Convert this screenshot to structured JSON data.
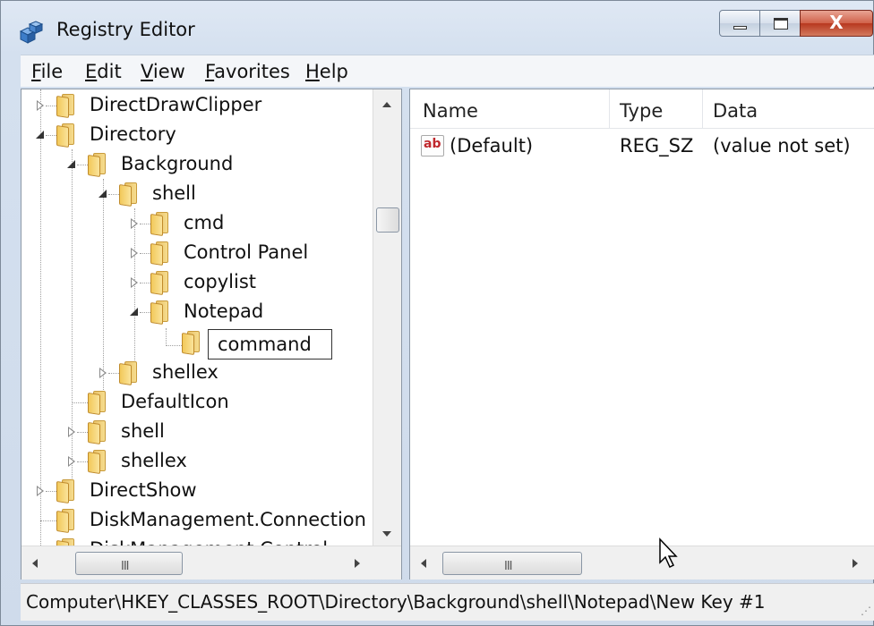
{
  "window": {
    "title": "Registry Editor",
    "app_icon": "registry-cubes-icon",
    "caption_buttons": {
      "minimize_icon": "minimize-icon",
      "maximize_icon": "maximize-icon",
      "close_icon": "close-icon",
      "close_glyph": "X"
    }
  },
  "menu": {
    "items": [
      {
        "accel": "F",
        "rest": "ile"
      },
      {
        "accel": "E",
        "rest": "dit"
      },
      {
        "accel": "V",
        "rest": "iew"
      },
      {
        "accel": "F",
        "rest": "avorites"
      },
      {
        "accel": "H",
        "rest": "elp"
      }
    ]
  },
  "tree": {
    "nodes": [
      {
        "label": "DirectDrawClipper",
        "state": "collapsed"
      },
      {
        "label": "Directory",
        "state": "expanded"
      },
      {
        "label": "Background",
        "state": "expanded"
      },
      {
        "label": "shell",
        "state": "expanded"
      },
      {
        "label": "cmd",
        "state": "collapsed"
      },
      {
        "label": "Control Panel",
        "state": "collapsed"
      },
      {
        "label": "copylist",
        "state": "collapsed"
      },
      {
        "label": "Notepad",
        "state": "expanded"
      },
      {
        "label": "command",
        "state": "renaming"
      },
      {
        "label": "shellex",
        "state": "collapsed"
      },
      {
        "label": "DefaultIcon",
        "state": "leaf"
      },
      {
        "label": "shell",
        "state": "collapsed"
      },
      {
        "label": "shellex",
        "state": "collapsed"
      },
      {
        "label": "DirectShow",
        "state": "collapsed"
      },
      {
        "label": "DiskManagement.Connection",
        "state": "leaf"
      },
      {
        "label": "DiskManagement.Control",
        "state": "collapsed"
      }
    ]
  },
  "list": {
    "columns": [
      "Name",
      "Type",
      "Data"
    ],
    "rows": [
      {
        "icon": "string-value-icon",
        "icon_text": "ab",
        "name": "(Default)",
        "type": "REG_SZ",
        "data": "(value not set)"
      }
    ]
  },
  "scroll": {
    "grip": "III"
  },
  "status": {
    "path": "Computer\\HKEY_CLASSES_ROOT\\Directory\\Background\\shell\\Notepad\\New Key #1"
  },
  "colors": {
    "folder": "#f2c95a",
    "close_button": "#c8462e",
    "string_icon": "#c0282d"
  }
}
